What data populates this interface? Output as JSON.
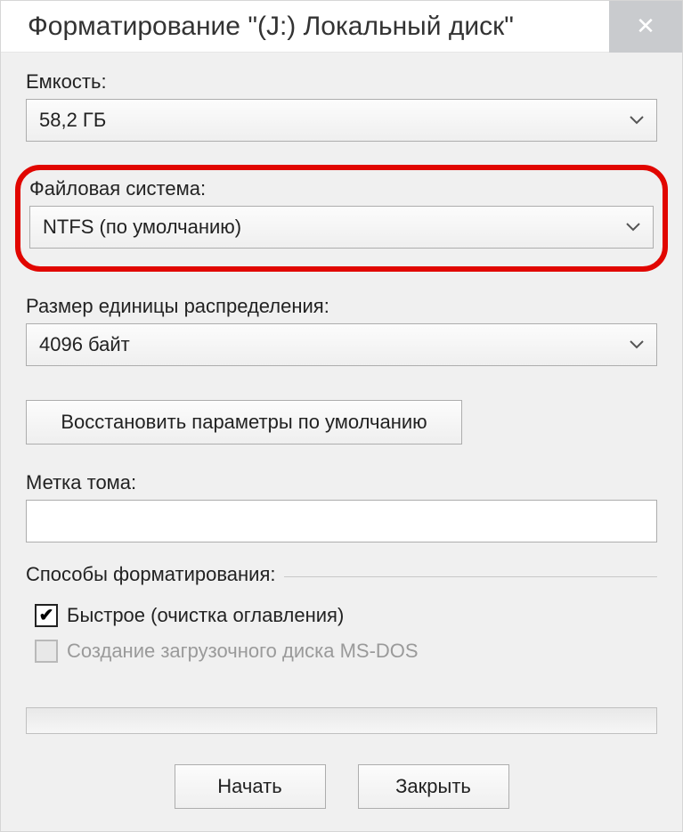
{
  "title": "Форматирование \"(J:) Локальный диск\"",
  "fields": {
    "capacity": {
      "label": "Емкость:",
      "value": "58,2 ГБ"
    },
    "filesystem": {
      "label": "Файловая система:",
      "value": "NTFS (по умолчанию)"
    },
    "allocation": {
      "label": "Размер единицы распределения:",
      "value": "4096 байт"
    },
    "volumeLabel": {
      "label": "Метка тома:",
      "value": ""
    }
  },
  "buttons": {
    "restoreDefaults": "Восстановить параметры по умолчанию",
    "start": "Начать",
    "close": "Закрыть"
  },
  "options": {
    "legend": "Способы форматирования:",
    "quickFormat": "Быстрое (очистка оглавления)",
    "msdosBoot": "Создание загрузочного диска MS-DOS"
  }
}
